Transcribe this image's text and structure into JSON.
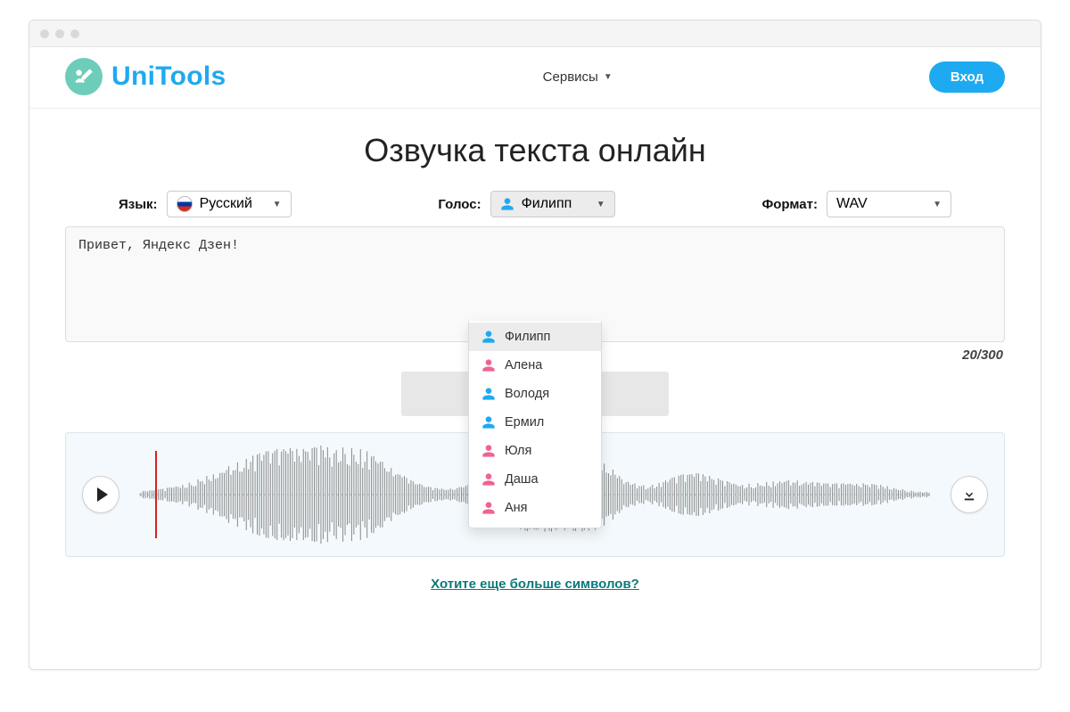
{
  "header": {
    "brand": "UniTools",
    "nav_services": "Сервисы",
    "login_label": "Вход"
  },
  "page": {
    "title": "Озвучка текста онлайн"
  },
  "controls": {
    "language_label": "Язык:",
    "language_value": "Русский",
    "voice_label": "Голос:",
    "voice_value": "Филипп",
    "format_label": "Формат:",
    "format_value": "WAV"
  },
  "voices": [
    {
      "name": "Филипп",
      "gender": "m"
    },
    {
      "name": "Алена",
      "gender": "f"
    },
    {
      "name": "Володя",
      "gender": "m"
    },
    {
      "name": "Ермил",
      "gender": "m"
    },
    {
      "name": "Юля",
      "gender": "f"
    },
    {
      "name": "Даша",
      "gender": "f"
    },
    {
      "name": "Аня",
      "gender": "f"
    }
  ],
  "textarea": {
    "value": "Привет, Яндекс Дзен!"
  },
  "char_count": "20/300",
  "footer": {
    "more_chars": "Хотите еще больше символов?"
  }
}
